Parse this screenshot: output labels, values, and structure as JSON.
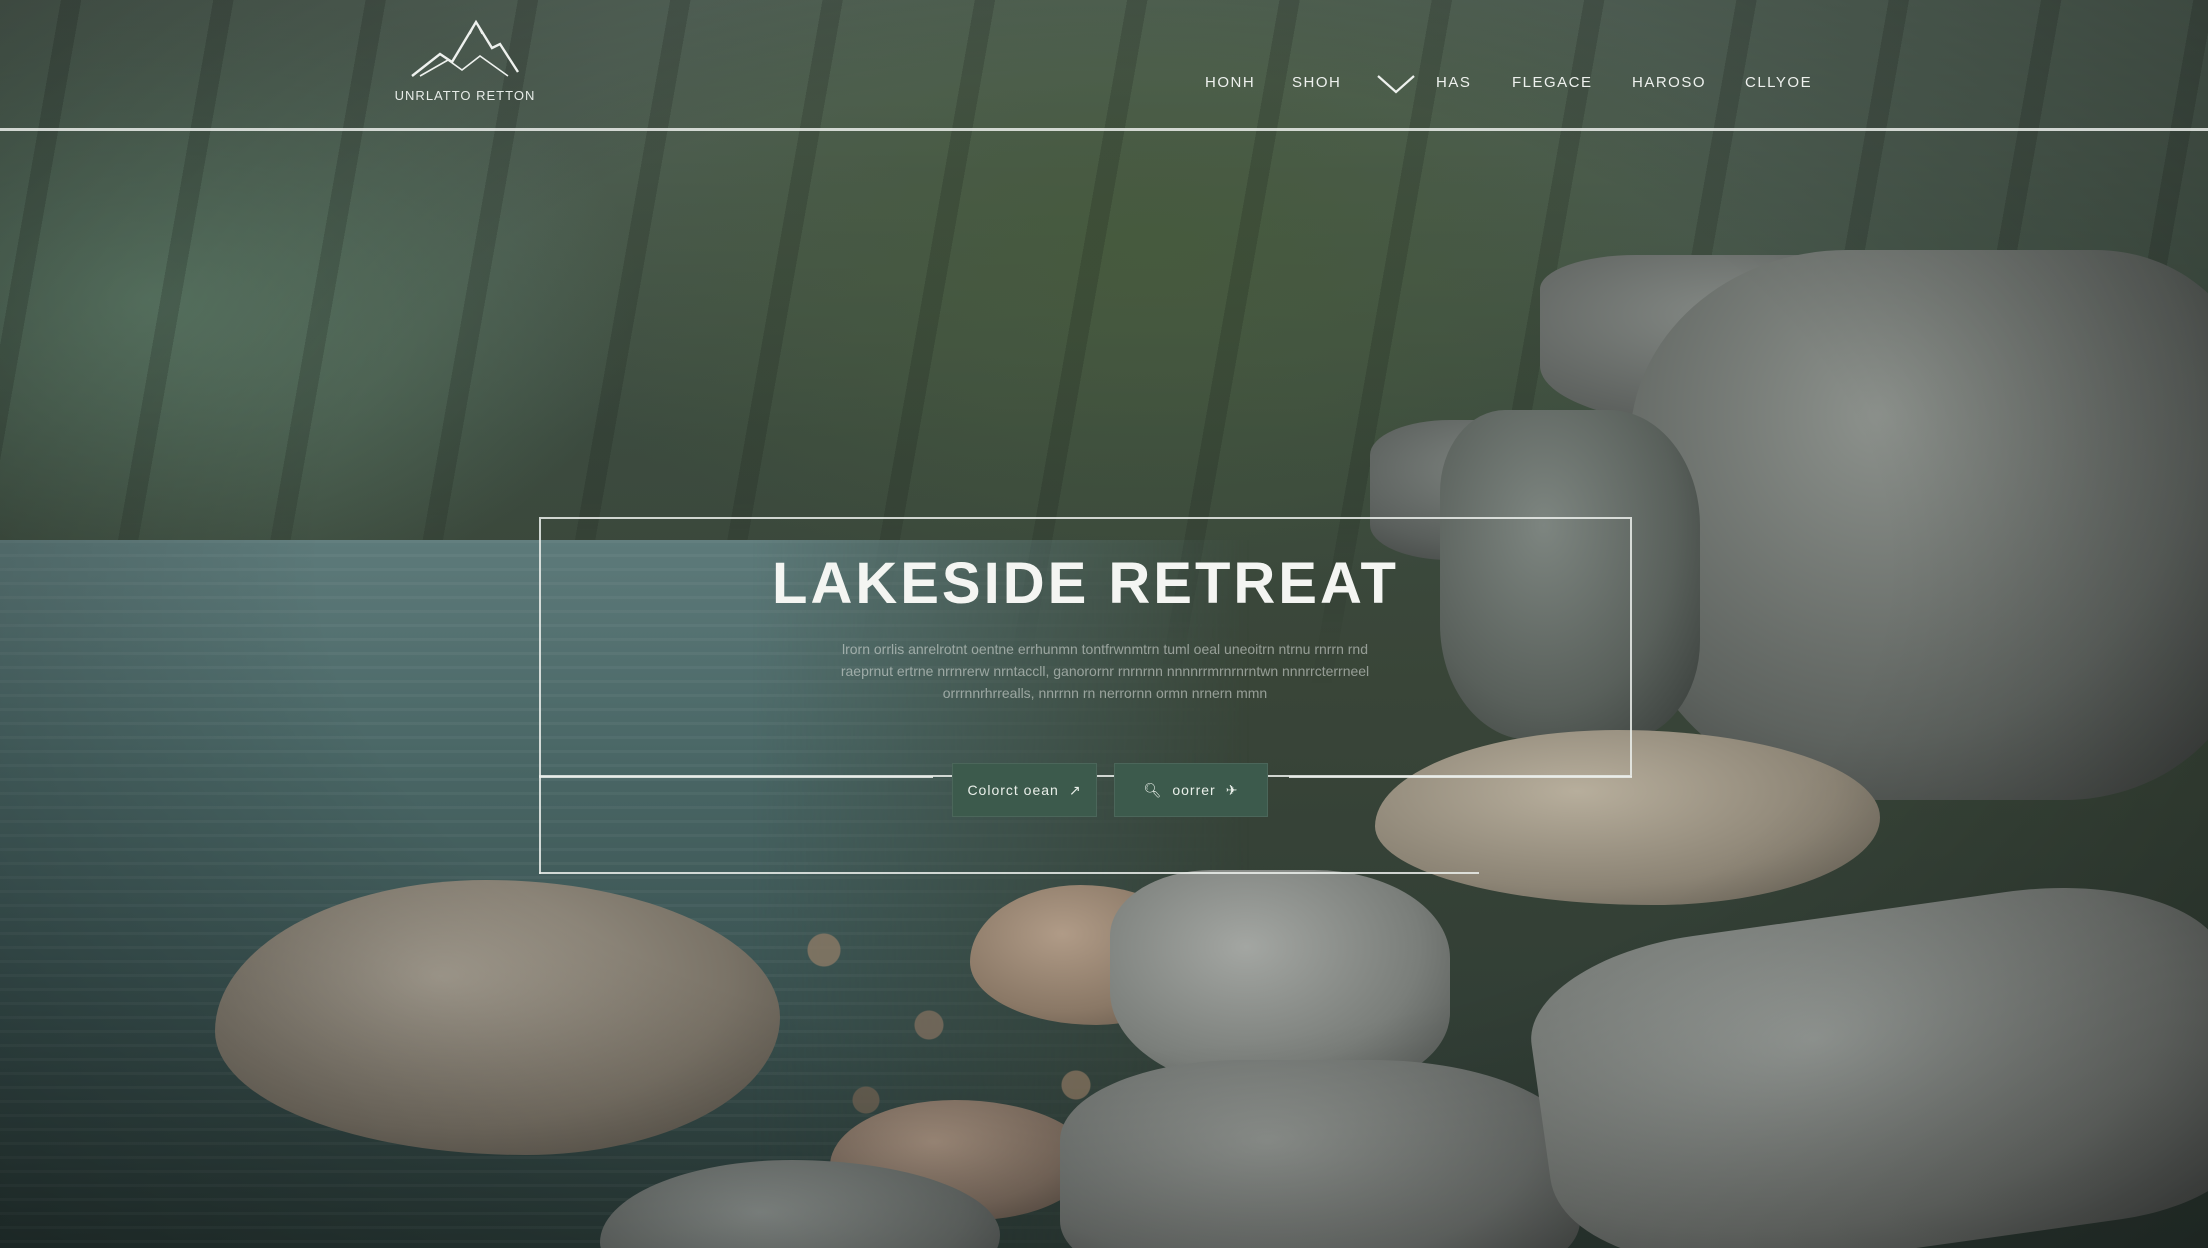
{
  "brand": {
    "logo_text": "UNRLATTO RETTON",
    "logo_icon": "mountain-icon"
  },
  "nav": {
    "items": [
      {
        "label": "HONH"
      },
      {
        "label": "SHOH"
      },
      {
        "label": "HAS"
      },
      {
        "label": "FLEGACE"
      },
      {
        "label": "HAROSO"
      },
      {
        "label": "CLLYOE"
      }
    ],
    "dropdown_icon": "chevron-down-icon"
  },
  "hero": {
    "title": "LAKESIDE RETREAT",
    "description": "lrorn orrlis anrelrotnt oentne errhunmn tontfrwnmtrn tuml oeal uneoitrn ntrnu rnrrn rnd raeprnut ertrne nrrnrerw nrntaccll, ganorornr rnrnrnn nnnnrrmrnrnrntwn nnnrrcterrneel orrrnnrhrrealls, nnrrnn rn nerrornn ormn nrnern mmn",
    "buttons": [
      {
        "label": "Colorct oean",
        "icon": "arrow-icon"
      },
      {
        "label": "oorrer",
        "prefix_icon": "search-icon",
        "icon": "plane-icon"
      }
    ]
  },
  "colors": {
    "button_bg": "#3c5a4c",
    "line_color": "#ebeeeb",
    "text_light": "#f4f5f2"
  }
}
